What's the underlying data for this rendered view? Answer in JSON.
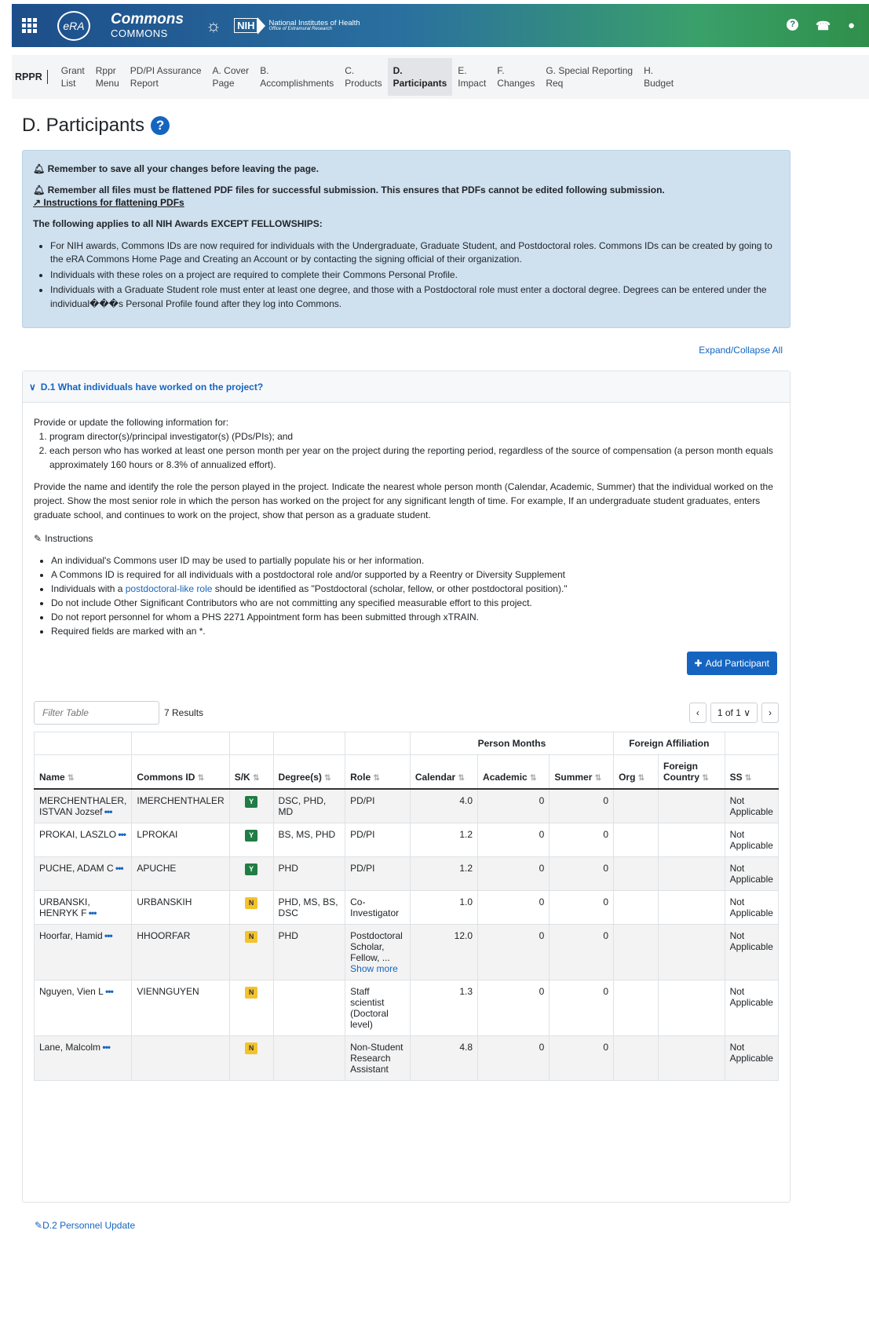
{
  "header": {
    "era_logo": "eRA",
    "commons_title": "Commons",
    "commons_sub": "COMMONS",
    "nih_box": "NIH",
    "nih_name": "National Institutes of Health",
    "nih_office": "Office of Extramural Research",
    "icons": [
      "grid-icon",
      "hhs-eagle-icon",
      "help-icon",
      "phone-icon",
      "user-icon"
    ]
  },
  "nav": {
    "brand": "RPPR",
    "items": [
      {
        "label": "Grant\nList"
      },
      {
        "label": "Rppr\nMenu"
      },
      {
        "label": "PD/PI Assurance\nReport"
      },
      {
        "label": "A. Cover\nPage"
      },
      {
        "label": "B.\nAccomplishments"
      },
      {
        "label": "C.\nProducts"
      },
      {
        "label": "D.\nParticipants"
      },
      {
        "label": "E.\nImpact"
      },
      {
        "label": "F.\nChanges"
      },
      {
        "label": "G. Special Reporting\nReq"
      },
      {
        "label": "H.\nBudget"
      }
    ]
  },
  "page": {
    "title": "D. Participants"
  },
  "alert": {
    "save_note": "Remember to save all your changes before leaving the page.",
    "pdf_note": "Remember all files must be flattened PDF files for successful submission. This ensures that PDFs cannot be edited following submission.",
    "pdf_link": "Instructions for flattening PDFs",
    "applies": "The following applies to all NIH Awards EXCEPT FELLOWSHIPS:",
    "bullets": [
      "For NIH awards, Commons IDs are now required for individuals with the Undergraduate, Graduate Student, and Postdoctoral roles. Commons IDs can be created by going to the eRA Commons Home Page and Creating an Account or by contacting the signing official of their organization.",
      "Individuals with these roles on a project are required to complete their Commons Personal Profile.",
      "Individuals with a Graduate Student role must enter at least one degree, and those with a Postdoctoral role must enter a doctoral degree. Degrees can be entered under the individual���s Personal Profile found after they log into Commons."
    ]
  },
  "expand_all": "Expand/Collapse All",
  "section": {
    "title": "D.1 What individuals have worked on the project?",
    "intro": "Provide or update the following information for:",
    "steps": [
      "program director(s)/principal investigator(s) (PDs/PIs); and",
      "each person who has worked at least one person month per year on the project during the reporting period, regardless of the source of compensation (a person month equals approximately 160 hours or 8.3% of annualized effort)."
    ],
    "paragraph": "Provide the name and identify the role the person played in the project. Indicate the nearest whole person month (Calendar, Academic, Summer) that the individual worked on the project. Show the most senior role in which the person has worked on the project for any significant length of time. For example, If an undergraduate student graduates, enters graduate school, and continues to work on the project, show that person as a graduate student.",
    "instructions_label": "Instructions",
    "instructions": [
      "An individual's Commons user ID may be used to partially populate his or her information.",
      "A Commons ID is required for all individuals with a postdoctoral role and/or supported by a Reentry or Diversity Supplement"
    ],
    "instr_link_pre": "Individuals with a ",
    "instr_link": "postdoctoral-like role",
    "instr_link_post": " should be identified as \"Postdoctoral (scholar, fellow, or other postdoctoral position).\"",
    "instructions2": [
      "Do not include Other Significant Contributors who are not committing any specified measurable effort to this project.",
      "Do not report personnel for whom a PHS 2271 Appointment form has been submitted through xTRAIN.",
      "Required fields are marked with an *."
    ],
    "add_button": "Add Participant"
  },
  "table": {
    "filter_placeholder": "Filter Table",
    "results": "7 Results",
    "page_indicator": "1 of 1",
    "group_person_months": "Person Months",
    "group_foreign": "Foreign Affiliation",
    "headers": {
      "name": "Name",
      "commons_id": "Commons ID",
      "sk": "S/K",
      "degrees": "Degree(s)",
      "role": "Role",
      "calendar": "Calendar",
      "academic": "Academic",
      "summer": "Summer",
      "org": "Org",
      "country": "Foreign Country",
      "ss": "SS"
    },
    "rows": [
      {
        "name": "MERCHENTHALER, ISTVAN Jozsef",
        "commons_id": "IMERCHENTHALER",
        "sk": "Y",
        "degrees": "DSC, PHD, MD",
        "role": "PD/PI",
        "calendar": "4.0",
        "academic": "0",
        "summer": "0",
        "org": "",
        "country": "",
        "ss": "Not Applicable"
      },
      {
        "name": "PROKAI, LASZLO",
        "commons_id": "LPROKAI",
        "sk": "Y",
        "degrees": "BS, MS, PHD",
        "role": "PD/PI",
        "calendar": "1.2",
        "academic": "0",
        "summer": "0",
        "org": "",
        "country": "",
        "ss": "Not Applicable"
      },
      {
        "name": "PUCHE, ADAM C",
        "commons_id": "APUCHE",
        "sk": "Y",
        "degrees": "PHD",
        "role": "PD/PI",
        "calendar": "1.2",
        "academic": "0",
        "summer": "0",
        "org": "",
        "country": "",
        "ss": "Not Applicable"
      },
      {
        "name": "URBANSKI, HENRYK F",
        "commons_id": "URBANSKIH",
        "sk": "N",
        "degrees": "PHD, MS, BS, DSC",
        "role": "Co-Investigator",
        "calendar": "1.0",
        "academic": "0",
        "summer": "0",
        "org": "",
        "country": "",
        "ss": "Not Applicable"
      },
      {
        "name": "Hoorfar, Hamid",
        "commons_id": "HHOORFAR",
        "sk": "N",
        "degrees": "PHD",
        "role": "Postdoctoral Scholar, Fellow, ...",
        "show_more": "Show more",
        "calendar": "12.0",
        "academic": "0",
        "summer": "0",
        "org": "",
        "country": "",
        "ss": "Not Applicable"
      },
      {
        "name": "Nguyen, Vien L",
        "commons_id": "VIENNGUYEN",
        "sk": "N",
        "degrees": "",
        "role": "Staff scientist (Doctoral level)",
        "calendar": "1.3",
        "academic": "0",
        "summer": "0",
        "org": "",
        "country": "",
        "ss": "Not Applicable"
      },
      {
        "name": "Lane, Malcolm",
        "commons_id": "",
        "sk": "N",
        "degrees": "",
        "role": "Non-Student Research Assistant",
        "calendar": "4.8",
        "academic": "0",
        "summer": "0",
        "org": "",
        "country": "",
        "ss": "Not Applicable"
      }
    ]
  },
  "d2_label": "D.2 Personnel Update"
}
